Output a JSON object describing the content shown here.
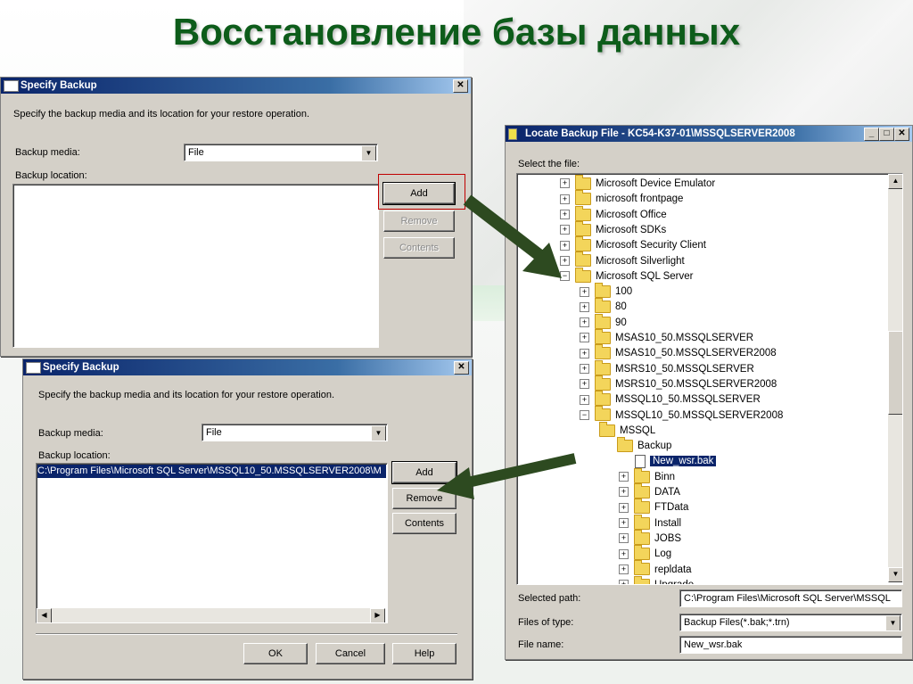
{
  "slide_title": "Восстановление базы данных",
  "dialog1": {
    "title": "Specify Backup",
    "description": "Specify the backup media and its location for your restore operation.",
    "media_label": "Backup media:",
    "media_value": "File",
    "location_label": "Backup location:",
    "add_label": "Add",
    "remove_label": "Remove",
    "contents_label": "Contents"
  },
  "dialog2": {
    "title": "Specify Backup",
    "description": "Specify the backup media and its location for your restore operation.",
    "media_label": "Backup media:",
    "media_value": "File",
    "location_label": "Backup location:",
    "location_item": "C:\\Program Files\\Microsoft SQL Server\\MSSQL10_50.MSSQLSERVER2008\\M",
    "add_label": "Add",
    "remove_label": "Remove",
    "contents_label": "Contents",
    "ok_label": "OK",
    "cancel_label": "Cancel",
    "help_label": "Help"
  },
  "locate": {
    "title": "Locate Backup File - KC54-K37-01\\MSSQLSERVER2008",
    "select_label": "Select the file:",
    "tree": [
      {
        "label": "Microsoft Device Emulator",
        "kind": "folder",
        "level": 0,
        "expander": "+"
      },
      {
        "label": "microsoft frontpage",
        "kind": "folder",
        "level": 0,
        "expander": "+"
      },
      {
        "label": "Microsoft Office",
        "kind": "folder",
        "level": 0,
        "expander": "+"
      },
      {
        "label": "Microsoft SDKs",
        "kind": "folder",
        "level": 0,
        "expander": "+"
      },
      {
        "label": "Microsoft Security Client",
        "kind": "folder",
        "level": 0,
        "expander": "+"
      },
      {
        "label": "Microsoft Silverlight",
        "kind": "folder",
        "level": 0,
        "expander": "+"
      },
      {
        "label": "Microsoft SQL Server",
        "kind": "folder",
        "level": 0,
        "expander": "-"
      },
      {
        "label": "100",
        "kind": "folder",
        "level": 1,
        "expander": "+"
      },
      {
        "label": "80",
        "kind": "folder",
        "level": 1,
        "expander": "+"
      },
      {
        "label": "90",
        "kind": "folder",
        "level": 1,
        "expander": "+"
      },
      {
        "label": "MSAS10_50.MSSQLSERVER",
        "kind": "folder",
        "level": 1,
        "expander": "+"
      },
      {
        "label": "MSAS10_50.MSSQLSERVER2008",
        "kind": "folder",
        "level": 1,
        "expander": "+"
      },
      {
        "label": "MSRS10_50.MSSQLSERVER",
        "kind": "folder",
        "level": 1,
        "expander": "+"
      },
      {
        "label": "MSRS10_50.MSSQLSERVER2008",
        "kind": "folder",
        "level": 1,
        "expander": "+"
      },
      {
        "label": "MSSQL10_50.MSSQLSERVER",
        "kind": "folder",
        "level": 1,
        "expander": "+"
      },
      {
        "label": "MSSQL10_50.MSSQLSERVER2008",
        "kind": "folder",
        "level": 1,
        "expander": "-"
      },
      {
        "label": "MSSQL",
        "kind": "folder",
        "level": 2,
        "expander": ""
      },
      {
        "label": "Backup",
        "kind": "folder",
        "level": 3,
        "expander": ""
      },
      {
        "label": "New_wsr.bak",
        "kind": "file",
        "level": 4,
        "expander": "",
        "selected": true
      },
      {
        "label": "Binn",
        "kind": "folder",
        "level": 3,
        "expander": "+"
      },
      {
        "label": "DATA",
        "kind": "folder",
        "level": 3,
        "expander": "+"
      },
      {
        "label": "FTData",
        "kind": "folder",
        "level": 3,
        "expander": "+"
      },
      {
        "label": "Install",
        "kind": "folder",
        "level": 3,
        "expander": "+"
      },
      {
        "label": "JOBS",
        "kind": "folder",
        "level": 3,
        "expander": "+"
      },
      {
        "label": "Log",
        "kind": "folder",
        "level": 3,
        "expander": "+"
      },
      {
        "label": "repldata",
        "kind": "folder",
        "level": 3,
        "expander": "+"
      },
      {
        "label": "Upgrade",
        "kind": "folder",
        "level": 3,
        "expander": "+"
      }
    ],
    "selected_path_label": "Selected path:",
    "selected_path_value": "C:\\Program Files\\Microsoft SQL Server\\MSSQL",
    "files_type_label": "Files of type:",
    "files_type_value": "Backup Files(*.bak;*.trn)",
    "file_name_label": "File name:",
    "file_name_value": "New_wsr.bak"
  },
  "colors": {
    "title_green": "#0d5c1a",
    "arrow_green": "#2d4a20",
    "selection_blue": "#0a246a"
  }
}
